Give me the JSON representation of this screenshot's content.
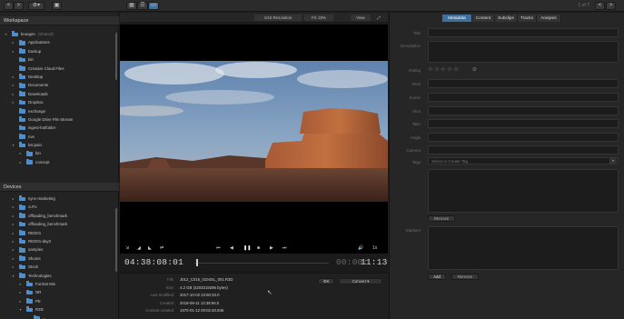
{
  "toolbar": {
    "back": "<",
    "forward": ">",
    "settings": "⚙▾",
    "save": "▣",
    "view_grid": "▦",
    "view_list": "☰",
    "view_viewer": "▭",
    "page_prev": "<",
    "page_next": ">",
    "page_count": "1 of 7"
  },
  "sidebar": {
    "workspace_title": "Workspace",
    "workspace_items": [
      {
        "label": "kruegen",
        "suffix": "(Shared)",
        "arrow": "▾"
      },
      {
        "label": "Applications",
        "arrow": "▸"
      },
      {
        "label": "backup",
        "arrow": "▸"
      },
      {
        "label": "bin",
        "arrow": ""
      },
      {
        "label": "Creative Cloud Files",
        "arrow": ""
      },
      {
        "label": "Desktop",
        "arrow": "▸"
      },
      {
        "label": "Documents",
        "arrow": "▸"
      },
      {
        "label": "Downloads",
        "arrow": "▸"
      },
      {
        "label": "Dropbox",
        "arrow": "▸"
      },
      {
        "label": "exchange",
        "arrow": ""
      },
      {
        "label": "Google Drive File Stream",
        "arrow": ""
      },
      {
        "label": "ingest-hotfolder",
        "arrow": ""
      },
      {
        "label": "nvs",
        "arrow": ""
      },
      {
        "label": "kscpain",
        "arrow": "▾"
      },
      {
        "label": "bin",
        "arrow": "▸"
      },
      {
        "label": "concept",
        "arrow": "▸"
      }
    ],
    "devices_title": "Devices",
    "device_items": [
      {
        "label": "sync-marketing",
        "arrow": "▸"
      },
      {
        "label": "cuTv",
        "arrow": "▸"
      },
      {
        "label": "offloading_benchmark",
        "arrow": "▸"
      },
      {
        "label": "offloading_benchmark",
        "arrow": "▸"
      },
      {
        "label": "RED01",
        "arrow": "▸"
      },
      {
        "label": "RED01-day2",
        "arrow": "▸"
      },
      {
        "label": "samples",
        "arrow": "▸"
      },
      {
        "label": "Shoots",
        "arrow": "▸"
      },
      {
        "label": "Stock",
        "arrow": "▸"
      },
      {
        "label": "Technologies",
        "arrow": "▾"
      },
      {
        "label": "Format Mix",
        "arrow": "▸"
      },
      {
        "label": "NR",
        "arrow": "▸"
      },
      {
        "label": "PE",
        "arrow": "▸"
      },
      {
        "label": "R3D",
        "arrow": "▾"
      },
      {
        "label": "...",
        "arrow": ""
      }
    ]
  },
  "viewer": {
    "resolution": "1/16 Resolution",
    "fit": "Fit: 33%",
    "view": "View",
    "expand": "⤢",
    "timecode_current": "04:38:08:01",
    "timecode_end_dim": "00:00:",
    "timecode_end": "11:13",
    "transport": {
      "marker": "⇲",
      "in": "◢",
      "out": "◣",
      "loop": "⇄",
      "to_start": "⏮",
      "step_back": "◀",
      "play": "❚❚",
      "stop": "■",
      "step_fwd": "▶",
      "to_end": "⏭",
      "audio": "🔊",
      "speed": "1x"
    }
  },
  "info": {
    "rows": [
      {
        "key": "File",
        "value": "J012_C015_0104SL_001.R3D"
      },
      {
        "key": "Size",
        "value": "4.2 GB (4203319296 bytes)"
      },
      {
        "key": "Last modified",
        "value": "2017-10-02 22:50:33.0"
      },
      {
        "key": "Created",
        "value": "2018-09-11 13:38:56.0"
      },
      {
        "key": "Content created",
        "value": "1970-01-12 00:02:40.846"
      }
    ],
    "convert_label": "Convert ▾",
    "gear_label": "⚙▾",
    "cursor": "↖"
  },
  "right_panel": {
    "tabs": [
      {
        "label": "Metadata",
        "active": true
      },
      {
        "label": "Content",
        "active": false
      },
      {
        "label": "Subclips",
        "active": false
      },
      {
        "label": "Tracks",
        "active": false
      },
      {
        "label": "Analysis",
        "active": false
      }
    ],
    "labels": {
      "title": "Title",
      "description": "Description",
      "rating": "Rating",
      "reel": "Reel",
      "scene": "Scene",
      "shot": "Shot",
      "take": "Take",
      "angle": "Angle",
      "camera": "Camera",
      "tags": "Tags",
      "markers": "Markers"
    },
    "rating_stars": "☆☆☆☆☆",
    "rating_clear": "⊘",
    "tags_placeholder": "Select or Create Tag",
    "remove_label": "Remove",
    "add_label": "Add",
    "remove2_label": "Remove"
  },
  "colors": {
    "accent": "#3e6f9f",
    "folder": "#4a8ed4"
  }
}
